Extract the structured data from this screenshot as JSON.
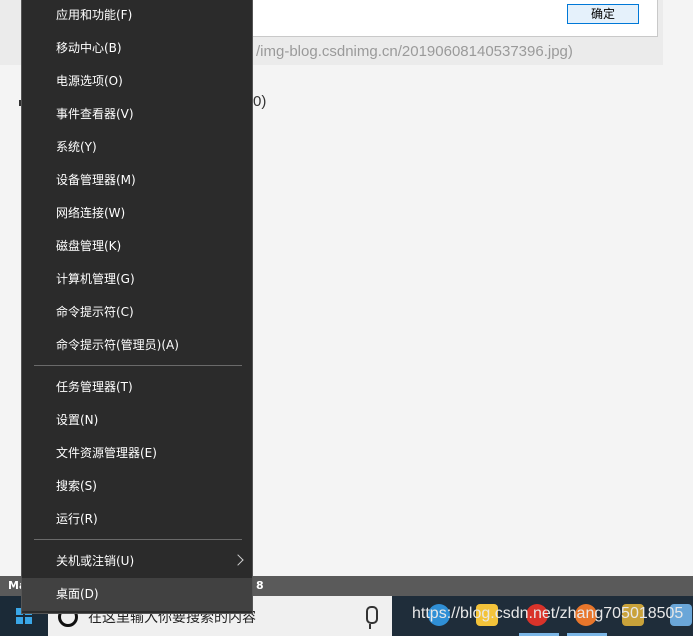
{
  "background": {
    "ok_button": "确定",
    "url_text": "/img-blog.csdnimg.cn/20190608140537396.jpg)",
    "paren_text": "0)"
  },
  "status_strip": {
    "left": "Ma",
    "right": "8"
  },
  "menu": {
    "groups": [
      [
        "应用和功能(F)",
        "移动中心(B)",
        "电源选项(O)",
        "事件查看器(V)",
        "系统(Y)",
        "设备管理器(M)",
        "网络连接(W)",
        "磁盘管理(K)",
        "计算机管理(G)",
        "命令提示符(C)",
        "命令提示符(管理员)(A)"
      ],
      [
        "任务管理器(T)",
        "设置(N)",
        "文件资源管理器(E)",
        "搜索(S)",
        "运行(R)"
      ],
      [
        "关机或注销(U)",
        "桌面(D)"
      ]
    ]
  },
  "taskbar": {
    "search_placeholder": "在这里输入你要搜索的内容",
    "overlay_url": "https://blog.csdn.net/zhang705018505"
  },
  "colors": {
    "menu_bg": "#2b2b2b",
    "menu_highlight": "#414141",
    "taskbar_bg": "#1f2d3a",
    "accent": "#0078d7"
  }
}
